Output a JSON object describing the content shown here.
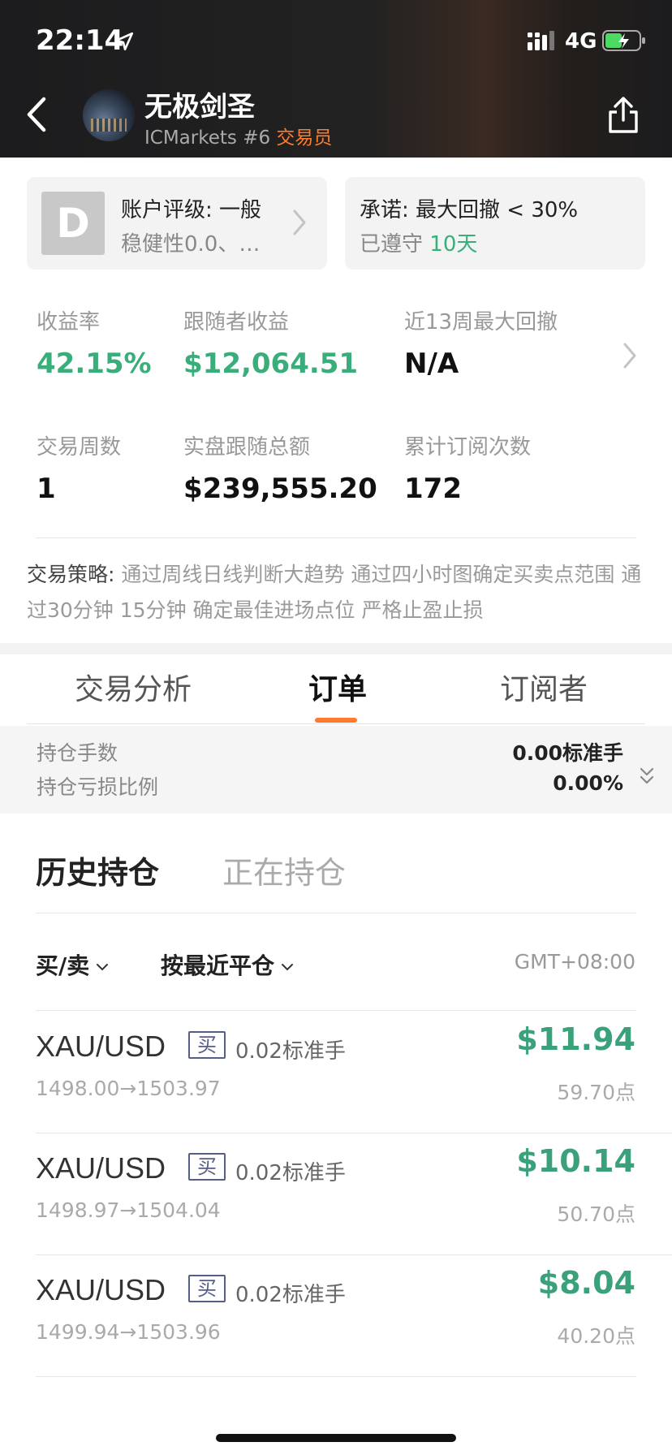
{
  "status_bar": {
    "time": "22:14",
    "network": "4G"
  },
  "trader": {
    "name": "无极剑圣",
    "broker": "ICMarkets #6",
    "role": "交易员"
  },
  "rating_card": {
    "grade": "D",
    "title": "账户评级: 一般",
    "subtitle": "稳健性0.0、…"
  },
  "promise_card": {
    "title": "承诺: 最大回撤 < 30%",
    "prefix": "已遵守",
    "days": "10天"
  },
  "stats": {
    "return_label": "收益率",
    "return_value": "42.15%",
    "follower_label": "跟随者收益",
    "follower_value": "$12,064.51",
    "drawdown_label": "近13周最大回撤",
    "drawdown_value": "N/A",
    "weeks_label": "交易周数",
    "weeks_value": "1",
    "total_label": "实盘跟随总额",
    "total_value": "$239,555.20",
    "subs_label": "累计订阅次数",
    "subs_value": "172"
  },
  "strategy": {
    "label": "交易策略: ",
    "text": "通过周线日线判断大趋势 通过四小时图确定买卖点范围 通过30分钟 15分钟 确定最佳进场点位 严格止盈止损"
  },
  "tabs": [
    "交易分析",
    "订单",
    "订阅者"
  ],
  "summary": {
    "lots_label": "持仓手数",
    "lots_value": "0.00标准手",
    "loss_label": "持仓亏损比例",
    "loss_value": "0.00%"
  },
  "subtabs": {
    "history": "历史持仓",
    "open": "正在持仓"
  },
  "filters": {
    "side": "买/卖",
    "sort": "按最近平仓",
    "timezone": "GMT+08:00"
  },
  "orders": [
    {
      "symbol": "XAU/USD",
      "side": "买",
      "lots": "0.02标准手",
      "prices": "1498.00→1503.97",
      "profit": "$11.94",
      "points": "59.70点"
    },
    {
      "symbol": "XAU/USD",
      "side": "买",
      "lots": "0.02标准手",
      "prices": "1498.97→1504.04",
      "profit": "$10.14",
      "points": "50.70点"
    },
    {
      "symbol": "XAU/USD",
      "side": "买",
      "lots": "0.02标准手",
      "prices": "1499.94→1503.96",
      "profit": "$8.04",
      "points": "40.20点"
    }
  ],
  "colors": {
    "accent": "#ff7a2e",
    "positive": "#3aae7a",
    "header_bg": "#1c1c1e"
  }
}
